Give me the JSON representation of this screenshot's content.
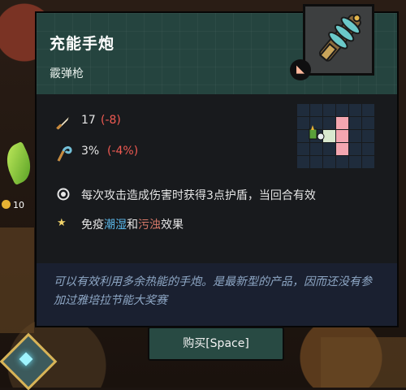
{
  "item": {
    "name": "充能手炮",
    "type": "霰弹枪",
    "icon": "cannon-gun-icon"
  },
  "stats": {
    "attack": {
      "value": "17",
      "delta": "(-8)",
      "icon": "sword-icon"
    },
    "crit": {
      "value": "3%",
      "delta": "(-4%)",
      "icon": "crit-hook-icon"
    }
  },
  "effects": {
    "effect1": "每次攻击造成伤害时获得3点护盾，当回合有效",
    "effect2_pre": "免疫",
    "effect2_kw1": "潮湿",
    "effect2_mid": "和",
    "effect2_kw2": "污浊",
    "effect2_post": "效果"
  },
  "description": "可以有效利用多余热能的手炮。是最新型的产品，因而还没有参加过雅培拉节能大奖赛",
  "buy_button": "购买[Space]",
  "background": {
    "coin_count": "10"
  },
  "colors": {
    "header_bg": "#25443f",
    "delta_red": "#f05a52",
    "wet_blue": "#5ab6e8",
    "dirty_red": "#d97a6a",
    "grid_pink": "#f3a6b0"
  }
}
